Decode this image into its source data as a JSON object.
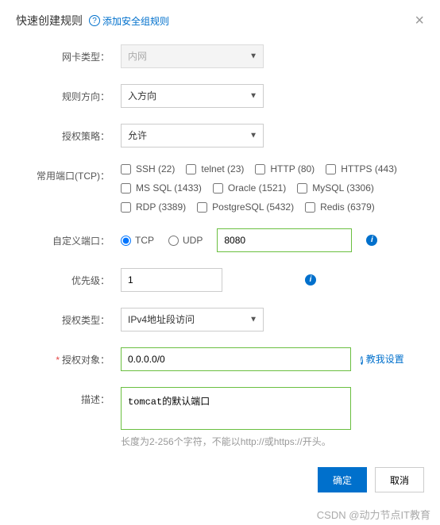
{
  "dialog": {
    "title": "快速创建规则",
    "help_link": "添加安全组规则",
    "close_label": "×"
  },
  "form": {
    "nic_type": {
      "label": "网卡类型：",
      "value": "内网"
    },
    "direction": {
      "label": "规则方向：",
      "value": "入方向"
    },
    "auth_policy": {
      "label": "授权策略：",
      "value": "允许"
    },
    "common_ports": {
      "label": "常用端口(TCP)：",
      "items": [
        {
          "label": "SSH (22)",
          "checked": false
        },
        {
          "label": "telnet (23)",
          "checked": false
        },
        {
          "label": "HTTP (80)",
          "checked": false
        },
        {
          "label": "HTTPS (443)",
          "checked": false
        },
        {
          "label": "MS SQL (1433)",
          "checked": false
        },
        {
          "label": "Oracle (1521)",
          "checked": false
        },
        {
          "label": "MySQL (3306)",
          "checked": false
        },
        {
          "label": "RDP (3389)",
          "checked": false
        },
        {
          "label": "PostgreSQL (5432)",
          "checked": false
        },
        {
          "label": "Redis (6379)",
          "checked": false
        }
      ]
    },
    "custom_port": {
      "label": "自定义端口：",
      "proto_tcp": "TCP",
      "proto_udp": "UDP",
      "value": "8080"
    },
    "priority": {
      "label": "优先级：",
      "value": "1"
    },
    "auth_type": {
      "label": "授权类型：",
      "value": "IPv4地址段访问"
    },
    "auth_object": {
      "label": "授权对象：",
      "required": true,
      "value": "0.0.0.0/0",
      "teach": "教我设置"
    },
    "description": {
      "label": "描述：",
      "value": "tomcat的默认端口",
      "hint": "长度为2-256个字符，不能以http://或https://开头。"
    }
  },
  "footer": {
    "ok": "确定",
    "cancel": "取消"
  },
  "watermark": "CSDN @动力节点IT教育"
}
